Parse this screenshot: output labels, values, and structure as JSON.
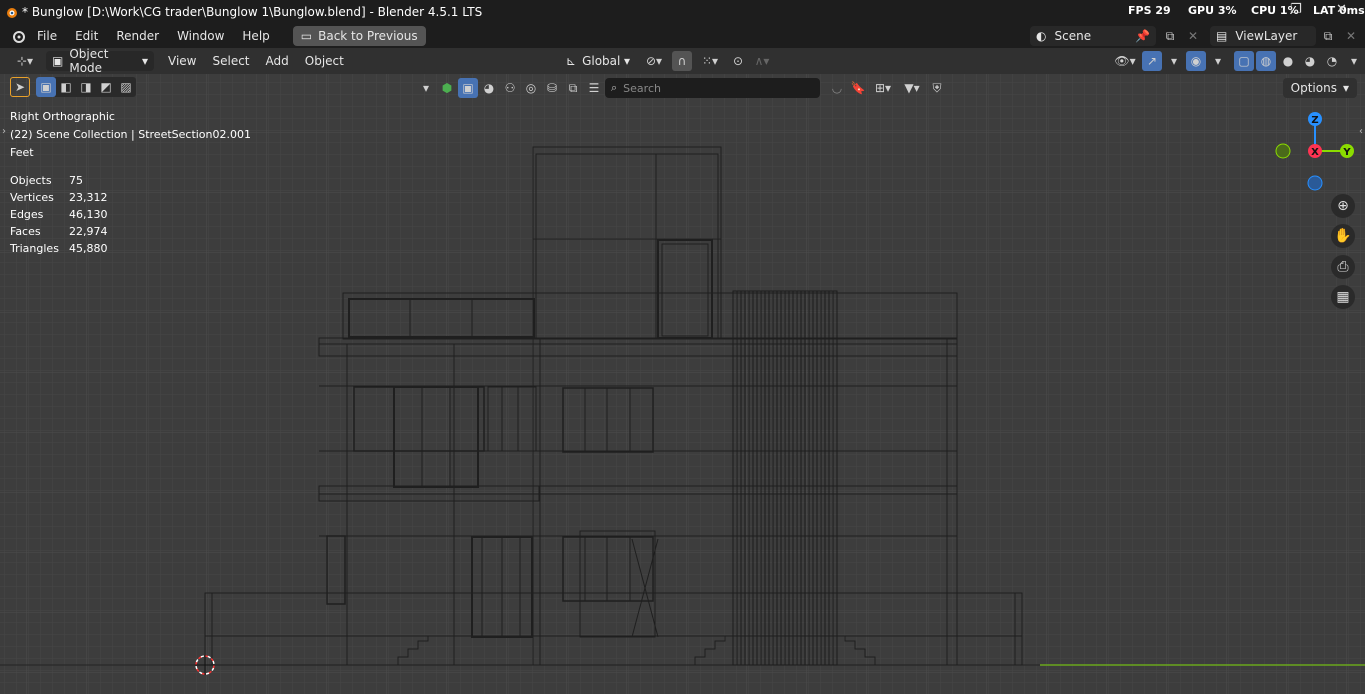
{
  "window": {
    "title": "* Bunglow [D:\\Work\\CG trader\\Bunglow 1\\Bunglow.blend] - Blender 4.5.1 LTS",
    "fps_label": "FPS",
    "fps_value": "29",
    "gpu_label": "GPU",
    "gpu_value": "3%",
    "cpu_label": "CPU",
    "cpu_value": "1%",
    "lat_label": "LAT",
    "lat_value": "0ms"
  },
  "menubar": {
    "items": [
      "File",
      "Edit",
      "Render",
      "Window",
      "Help"
    ],
    "back_button": "Back to Previous",
    "scene": "Scene",
    "view_layer": "ViewLayer"
  },
  "header": {
    "mode": "Object Mode",
    "menus": [
      "View",
      "Select",
      "Add",
      "Object"
    ],
    "transform_orientation": "Global"
  },
  "toolbar": {
    "search_placeholder": "Search",
    "options_label": "Options"
  },
  "viewport": {
    "view_name": "Right Orthographic",
    "collection": "(22) Scene Collection | StreetSection02.001",
    "units": "Feet",
    "stats": [
      {
        "label": "Objects",
        "value": "75"
      },
      {
        "label": "Vertices",
        "value": "23,312"
      },
      {
        "label": "Edges",
        "value": "46,130"
      },
      {
        "label": "Faces",
        "value": "22,974"
      },
      {
        "label": "Triangles",
        "value": "45,880"
      }
    ],
    "gizmo": {
      "z": "Z",
      "x": "X",
      "y": "Y"
    }
  },
  "colors": {
    "accent": "#4772b3",
    "axis_x": "#ff3352",
    "axis_y": "#8bdc00",
    "axis_z": "#2890ff"
  }
}
